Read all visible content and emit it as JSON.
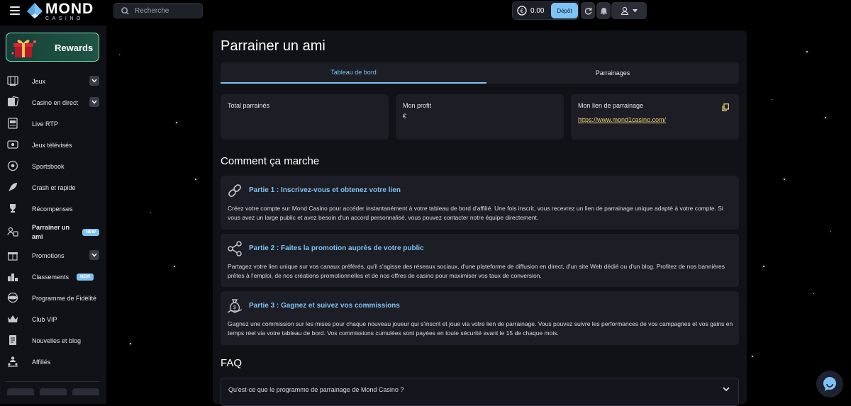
{
  "brand": {
    "name": "MOND",
    "sub": "CASINO",
    "accent": "#7ec3f4",
    "link_color": "#e8d37a"
  },
  "search": {
    "placeholder": "Recherche"
  },
  "header": {
    "balance": "0.00",
    "currency_icon": "euro-icon",
    "deposit_label": "Dépôt"
  },
  "sidebar": {
    "rewards_label": "Rewards",
    "items": [
      {
        "label": "Jeux",
        "icon": "games-icon",
        "chevron": true
      },
      {
        "label": "Casino en direct",
        "icon": "live-casino-icon",
        "chevron": true
      },
      {
        "label": "Live RTP",
        "icon": "rtp-icon"
      },
      {
        "label": "Jeux télévisés",
        "icon": "tv-icon"
      },
      {
        "label": "Sportsbook",
        "icon": "football-icon"
      },
      {
        "label": "Crash et rapide",
        "icon": "rocket-icon"
      },
      {
        "label": "Récompenses",
        "icon": "trophy-icon"
      },
      {
        "label": "Parrainer un ami",
        "icon": "referral-icon",
        "badge": "NEW",
        "active": true
      },
      {
        "label": "Promotions",
        "icon": "gift-icon",
        "chevron": true
      },
      {
        "label": "Classements",
        "icon": "leaderboard-icon",
        "badge": "NEW"
      },
      {
        "label": "Programme de Fidélité",
        "icon": "loyalty-icon"
      },
      {
        "label": "Club VIP",
        "icon": "crown-icon"
      },
      {
        "label": "Nouvelles et blog",
        "icon": "news-icon"
      },
      {
        "label": "Affiliés",
        "icon": "affiliates-icon"
      }
    ]
  },
  "main": {
    "title": "Parrainer un ami",
    "tabs": [
      {
        "label": "Tableau de bord",
        "active": true
      },
      {
        "label": "Parrainages",
        "active": false
      }
    ],
    "cards": {
      "total": {
        "title": "Total parrainés",
        "value": ""
      },
      "profit": {
        "title": "Mon profit",
        "value": "€"
      },
      "link": {
        "title": "Mon lien de parrainage",
        "url": "https://www.mond1casino.com/"
      }
    },
    "how_title": "Comment ça marche",
    "steps": [
      {
        "title": "Partie 1 : Inscrivez-vous et obtenez votre lien",
        "icon": "link-icon",
        "text": "Créez votre compte sur Mond Casino pour accéder instantanément à votre tableau de bord d'affilié. Une fois inscrit, vous recevrez un lien de parrainage unique adapté à votre compte. Si vous avez un large public et avez besoin d'un accord personnalisé, vous pouvez contacter notre équipe directement."
      },
      {
        "title": "Partie 2 : Faites la promotion auprès de votre public",
        "icon": "share-icon",
        "text": "Partagez votre lien unique sur vos canaux préférés, qu'il s'agisse des réseaux sociaux, d'une plateforme de diffusion en direct, d'un site Web dédié ou d'un blog. Profitez de nos bannières prêtes à l'emploi, de nos créations promotionnelles et de nos offres de casino pour maximiser vos taux de conversion."
      },
      {
        "title": "Partie 3 : Gagnez et suivez vos commissions",
        "icon": "money-icon",
        "text": "Gagnez une commission sur les mises pour chaque nouveau joueur qui s'inscrit et joue via votre lien de parrainage. Vous pouvez suivre les performances de vos campagnes et vos gains en temps réel via votre tableau de bord. Vos commissions cumulées sont payées en toute sécurité avant le 15 de chaque mois."
      }
    ],
    "faq_title": "FAQ",
    "faq": [
      {
        "question": "Qu'est-ce que le programme de parrainage de Mond Casino ?"
      }
    ]
  }
}
